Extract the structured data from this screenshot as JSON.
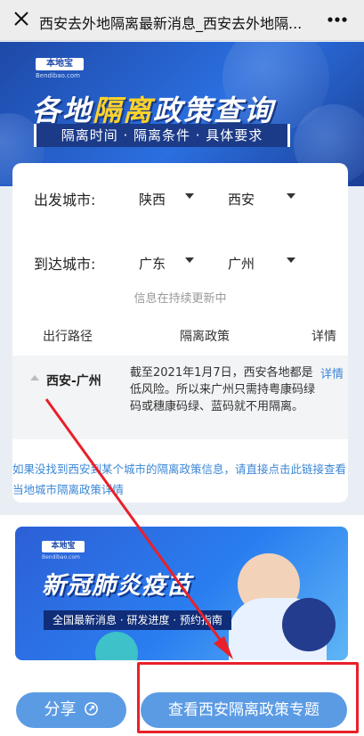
{
  "topbar": {
    "title": "西安去外地隔离最新消息_西安去外地隔...",
    "close_icon": "close-icon",
    "more_icon": "more-icon"
  },
  "banner": {
    "logo": "本地宝",
    "logo_sub": "Bendibao.com",
    "headline_before": "各地",
    "headline_highlight": "隔离",
    "headline_after": "政策查询",
    "tagline": "隔离时间 · 隔离条件 · 具体要求",
    "colors": {
      "highlight": "#ffd32a",
      "background": "#2b6fe0"
    }
  },
  "form": {
    "departure_label": "出发城市:",
    "departure_province": "陕西",
    "departure_city": "西安",
    "arrival_label": "到达城市:",
    "arrival_province": "广东",
    "arrival_city": "广州",
    "update_note": "信息在持续更新中"
  },
  "table": {
    "headers": [
      "出行路径",
      "隔离政策",
      "详情"
    ],
    "rows": [
      {
        "route": "西安-广州",
        "policy": "截至2021年1月7日，西安各地都是低风险。所以来广州只需持粤康码绿码或穗康码绿、蓝码就不用隔离。",
        "detail": "详情"
      }
    ]
  },
  "help_text": "如果没找到西安到某个城市的隔离政策信息，请直接点击此链接查看当地城市隔离政策详情",
  "vaccine_banner": {
    "logo": "本地宝",
    "logo_sub": "Bendibao.com",
    "headline": "新冠肺炎疫苗",
    "tagline": "全国最新消息 · 研发进度 · 预约指南"
  },
  "buttons": {
    "share_label": "分享",
    "share_icon": "share-icon",
    "topic_label": "查看西安隔离政策专题"
  },
  "colors": {
    "link": "#3b87d6",
    "button": "#5b9be4",
    "annotation": "#e8202a"
  }
}
